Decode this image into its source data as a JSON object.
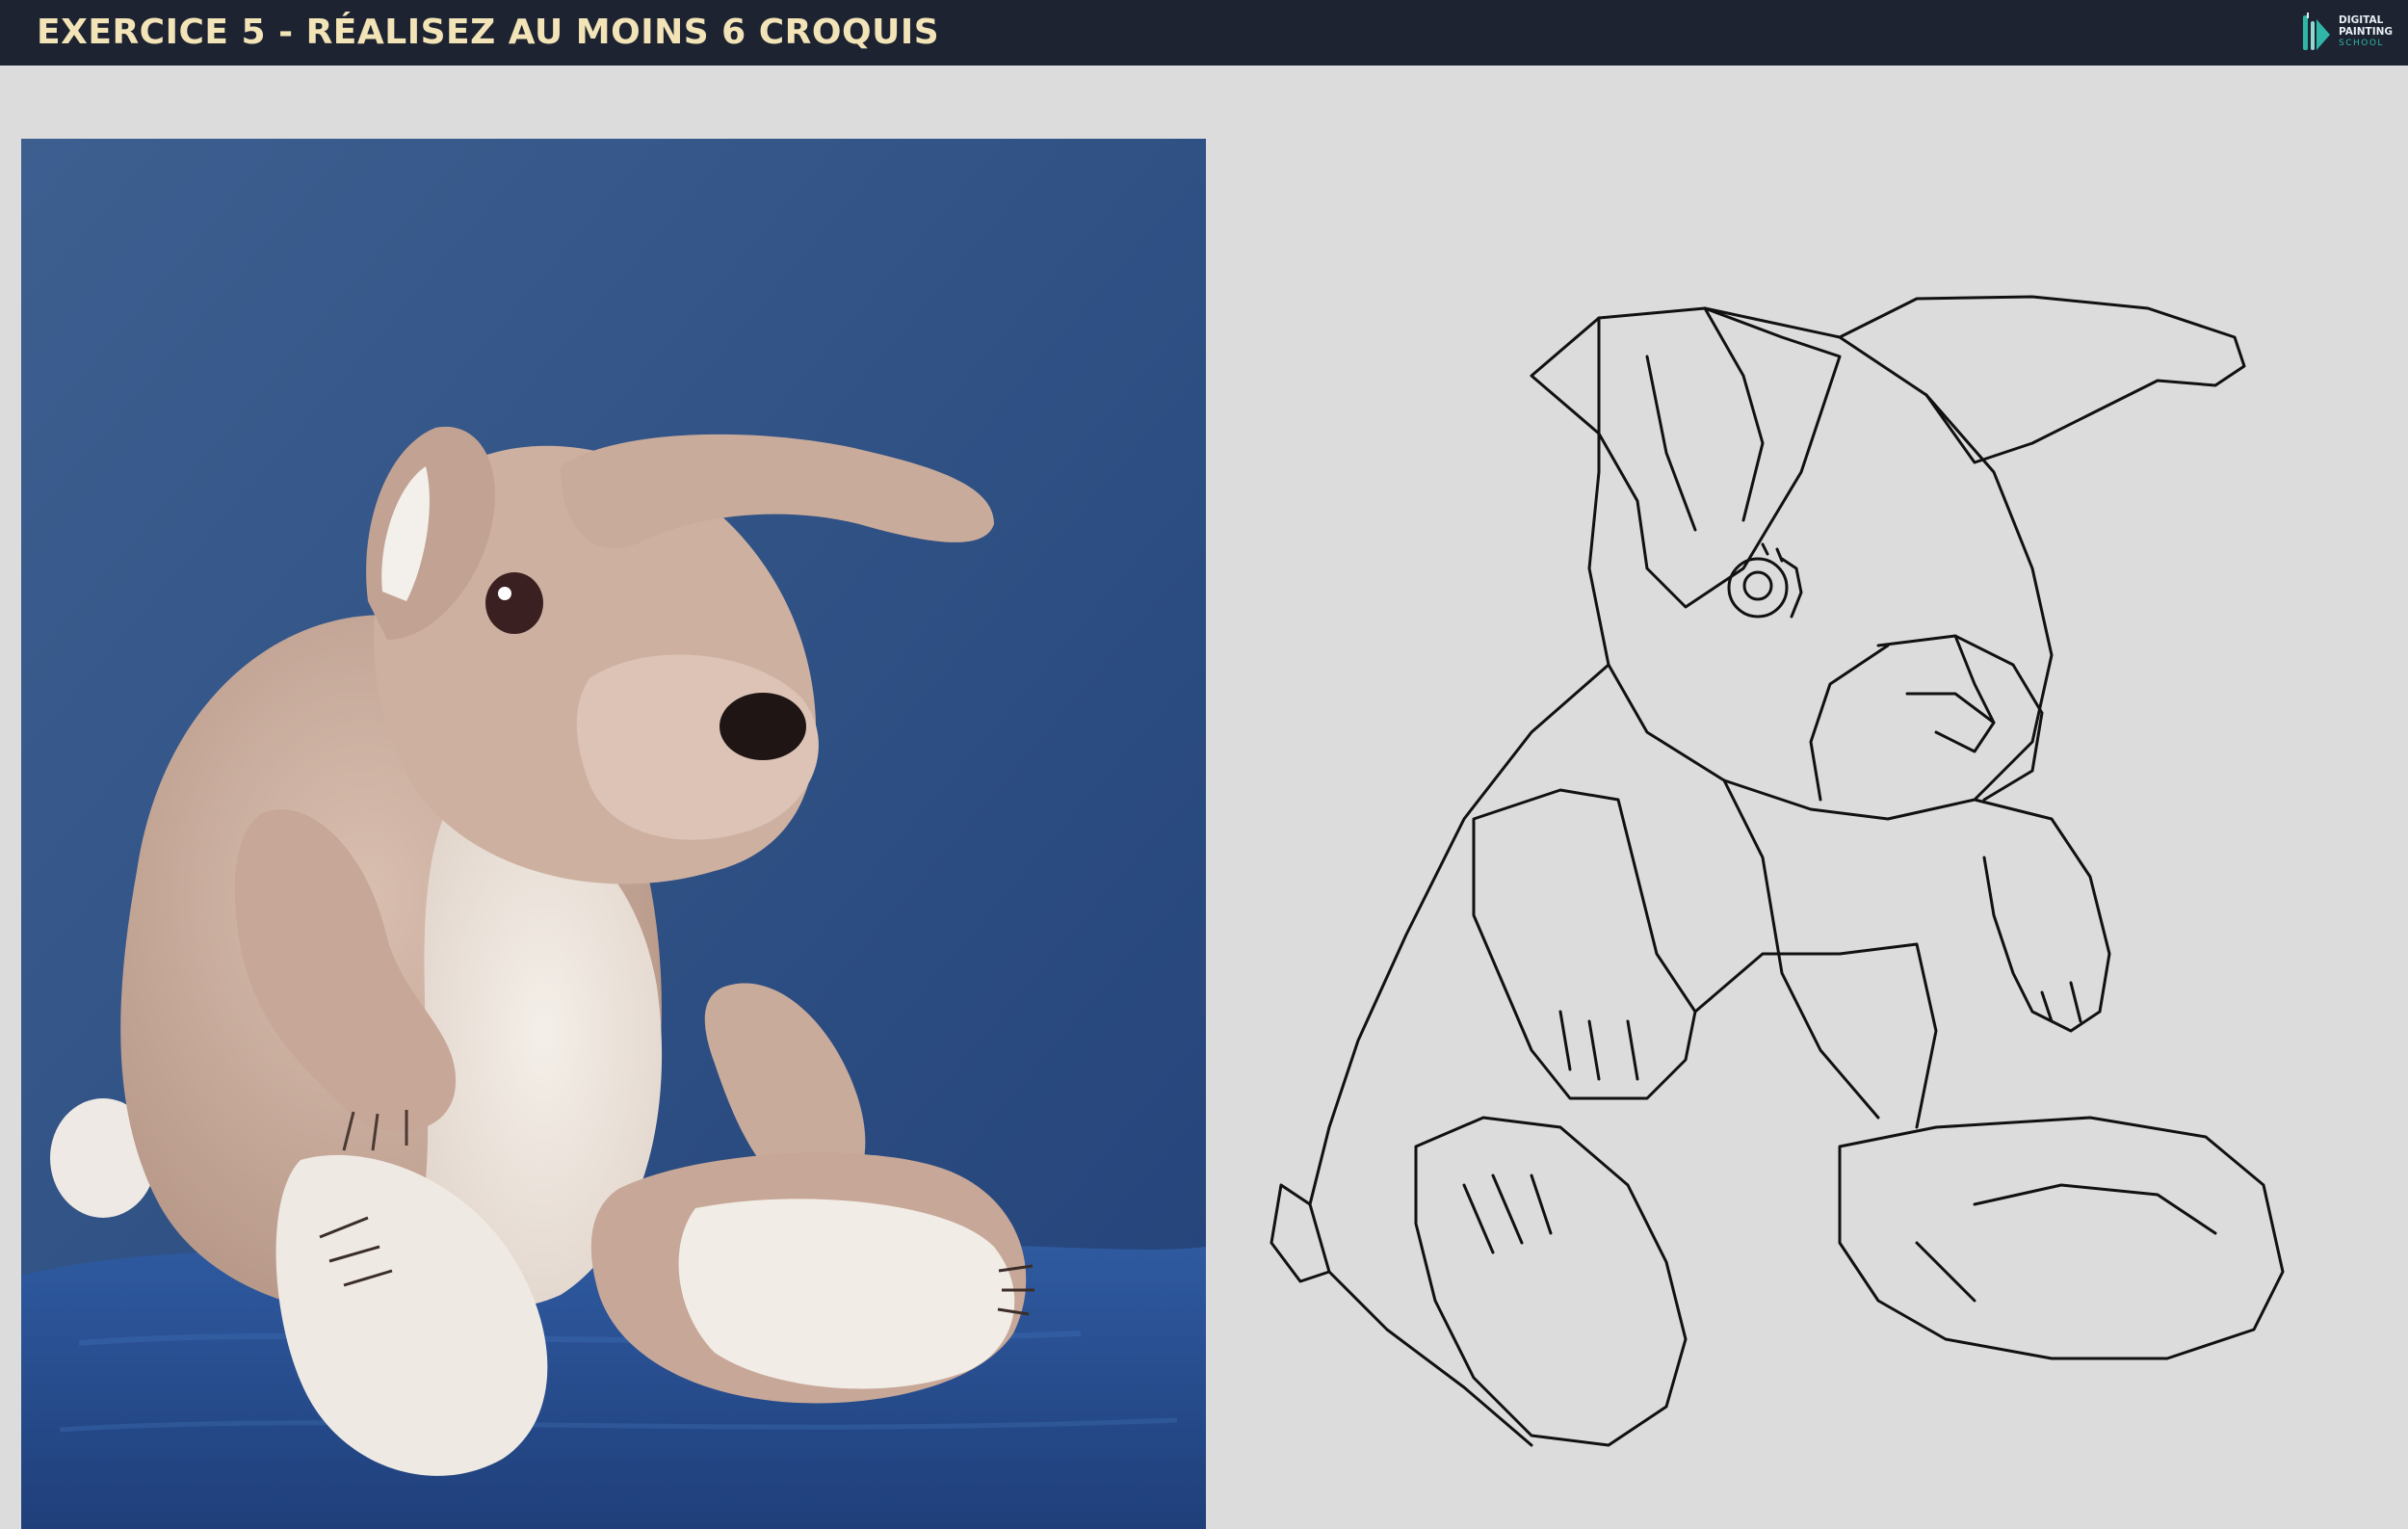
{
  "header": {
    "title": "EXERCICE 5 - RÉALISEZ AU MOINS 6 CROQUIS",
    "logo": {
      "line1": "DIGITAL",
      "line2": "PAINTING",
      "line3": "SCHOOL",
      "icon": "brush-logo-icon"
    }
  },
  "colors": {
    "header_bg": "#1d2331",
    "title": "#f3e4b8",
    "canvas_bg": "#dcdcdc",
    "photo_bg": "#2e4e7f",
    "plush": "#c9ab9b",
    "sketch_line": "#111111"
  }
}
